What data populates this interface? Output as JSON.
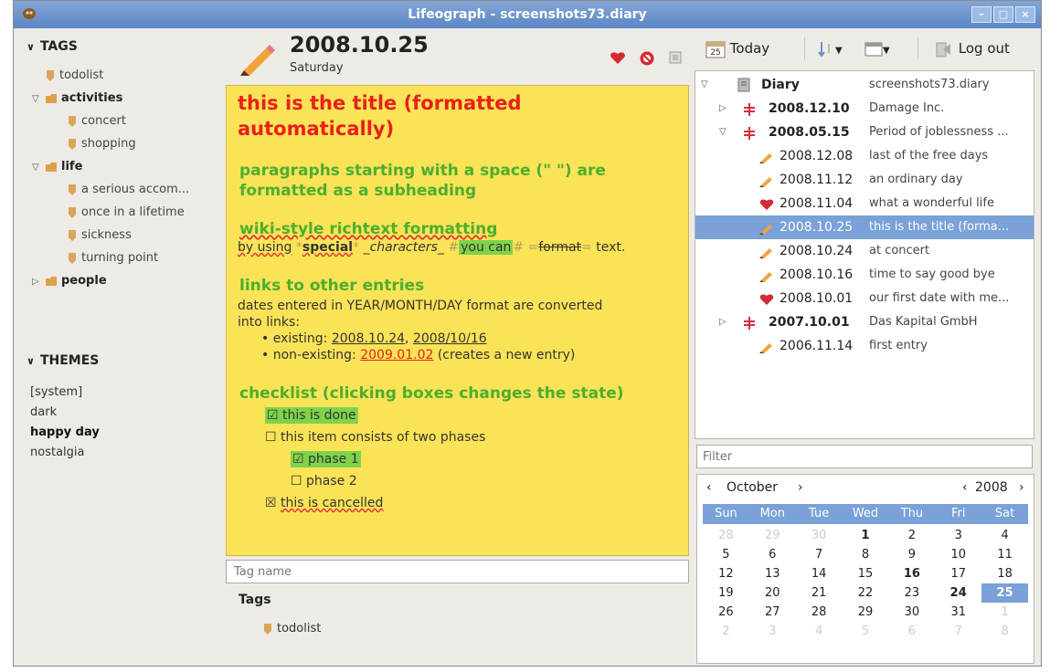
{
  "window": {
    "title": "Lifeograph - screenshots73.diary"
  },
  "colors": {
    "accent": "#7aa1d8",
    "editor_bg": "#fbe357",
    "title_red": "#e8201c",
    "subheading_green": "#4cae2f",
    "highlight_green": "#7fd34b"
  },
  "tags_panel": {
    "header": "TAGS",
    "items": [
      {
        "label": "todolist",
        "level": 0,
        "expander": "",
        "bold": false
      },
      {
        "label": "activities",
        "level": 0,
        "expander": "▽",
        "bold": true
      },
      {
        "label": "concert",
        "level": 1,
        "expander": "",
        "bold": false
      },
      {
        "label": "shopping",
        "level": 1,
        "expander": "",
        "bold": false
      },
      {
        "label": "life",
        "level": 0,
        "expander": "▽",
        "bold": true
      },
      {
        "label": "a serious accom...",
        "level": 1,
        "expander": "",
        "bold": false
      },
      {
        "label": "once in a lifetime",
        "level": 1,
        "expander": "",
        "bold": false
      },
      {
        "label": "sickness",
        "level": 1,
        "expander": "",
        "bold": false
      },
      {
        "label": "turning point",
        "level": 1,
        "expander": "",
        "bold": false
      },
      {
        "label": "people",
        "level": 0,
        "expander": "▷",
        "bold": true
      }
    ]
  },
  "themes_panel": {
    "header": "THEMES",
    "items": [
      {
        "label": "[system]",
        "bold": false
      },
      {
        "label": "dark",
        "bold": false
      },
      {
        "label": "happy day",
        "bold": true
      },
      {
        "label": "nostalgia",
        "bold": false
      }
    ]
  },
  "entry": {
    "date": "2008.10.25",
    "weekday": "Saturday",
    "title_line1": "this is the title (formatted",
    "title_line2": "automatically)",
    "sub1_line1": " paragraphs starting with a space (\" \") are",
    "sub1_line2": "formatted as a subheading",
    "sub2": " wiki-style richtext formatting",
    "rich_by": "by using",
    "rich_special": "special",
    "rich_characters": "_characters_",
    "rich_youcan": "you can",
    "rich_format": "format",
    "rich_text": "text.",
    "rich_mark_star": "*",
    "rich_mark_hash": "#",
    "rich_mark_eq": "=",
    "sub3": " links to other entries",
    "links_body1": "dates entered in YEAR/MONTH/DAY format are converted",
    "links_body2": "into links:",
    "existing_label": "• existing: ",
    "existing_link1": "2008.10.24",
    "existing_sep": ", ",
    "existing_link2": "2008/10/16",
    "nonexisting_label": "• non-existing: ",
    "nonexisting_link": "2009.01.02",
    "nonexisting_note": " (creates a new entry)",
    "sub4": " checklist (clicking boxes changes the state)",
    "check_done": "this is done",
    "check_two_phases": "this item consists of two phases",
    "check_phase1": "phase 1",
    "check_phase2": "phase 2",
    "check_cancelled": "this is cancelled",
    "check_mark_done": "☑",
    "check_mark_open": "☐",
    "check_mark_cancel": "☒"
  },
  "tag_input": {
    "placeholder": "Tag name"
  },
  "entry_tags": {
    "header": "Tags",
    "items": [
      "todolist"
    ]
  },
  "toolbar": {
    "today": "Today",
    "logout": "Log out"
  },
  "tree": {
    "root_label": "Diary",
    "root_file": "screenshots73.diary",
    "rows": [
      {
        "date": "2008.12.10",
        "desc": "Damage Inc.",
        "kind": "chapter",
        "expander": "▷",
        "bold": true,
        "selected": false
      },
      {
        "date": "2008.05.15",
        "desc": "Period of joblessness ...",
        "kind": "chapter",
        "expander": "▽",
        "bold": true,
        "selected": false
      },
      {
        "date": "2008.12.08",
        "desc": "last of the free days",
        "kind": "pen",
        "expander": "",
        "bold": false,
        "selected": false
      },
      {
        "date": "2008.11.12",
        "desc": "an ordinary day",
        "kind": "pen",
        "expander": "",
        "bold": false,
        "selected": false
      },
      {
        "date": "2008.11.04",
        "desc": "what a wonderful life",
        "kind": "heart",
        "expander": "",
        "bold": false,
        "selected": false
      },
      {
        "date": "2008.10.25",
        "desc": "this is the title (forma...",
        "kind": "pen",
        "expander": "",
        "bold": false,
        "selected": true
      },
      {
        "date": "2008.10.24",
        "desc": "at concert",
        "kind": "pen",
        "expander": "",
        "bold": false,
        "selected": false
      },
      {
        "date": "2008.10.16",
        "desc": "time to say good bye",
        "kind": "pen",
        "expander": "",
        "bold": false,
        "selected": false
      },
      {
        "date": "2008.10.01",
        "desc": "our first date with me...",
        "kind": "heart",
        "expander": "",
        "bold": false,
        "selected": false
      },
      {
        "date": "2007.10.01",
        "desc": "Das Kapital GmbH",
        "kind": "chapter",
        "expander": "▷",
        "bold": true,
        "selected": false
      },
      {
        "date": "2006.11.14",
        "desc": "first entry",
        "kind": "pen",
        "expander": "",
        "bold": false,
        "selected": false
      }
    ]
  },
  "filter": {
    "placeholder": "Filter"
  },
  "calendar": {
    "month_prev": "‹",
    "month": "October",
    "month_next": "›",
    "year_prev": "‹",
    "year": "2008",
    "year_next": "›",
    "weekdays": [
      "Sun",
      "Mon",
      "Tue",
      "Wed",
      "Thu",
      "Fri",
      "Sat"
    ],
    "weeks": [
      [
        "28",
        "29",
        "30",
        "1",
        "2",
        "3",
        "4"
      ],
      [
        "5",
        "6",
        "7",
        "8",
        "9",
        "10",
        "11"
      ],
      [
        "12",
        "13",
        "14",
        "15",
        "16",
        "17",
        "18"
      ],
      [
        "19",
        "20",
        "21",
        "22",
        "23",
        "24",
        "25"
      ],
      [
        "26",
        "27",
        "28",
        "29",
        "30",
        "31",
        "1"
      ],
      [
        "2",
        "3",
        "4",
        "5",
        "6",
        "7",
        "8"
      ]
    ],
    "bold_days": [
      "1",
      "16",
      "24"
    ],
    "selected_day": "25"
  }
}
